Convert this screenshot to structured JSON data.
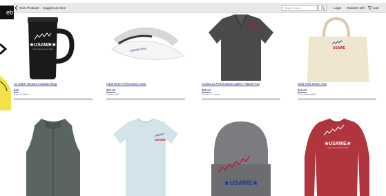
{
  "left_strip": {
    "badge_text": "eb"
  },
  "nav": {
    "new_products": "New Products",
    "suggest_item": "Suggest an Item",
    "search_placeholder": "Search Store",
    "login": "Login",
    "redeem_gift": "Redeem Gift",
    "cart": "Cart"
  },
  "products": [
    {
      "title": "oz. Black Vacuum Insulated Mug",
      "price": "$30",
      "brand": "Jazz Galtinz"
    },
    {
      "title": "Adult Drive Performance Visor",
      "price": "$20.00",
      "brand": "Game Mill"
    },
    {
      "title": "CrownLux Performance Ladies' Plaited Polo",
      "price": "$39.00",
      "brand": "Devon & Jones"
    },
    {
      "title": "Ideal Twill Jumbo Tote",
      "price": "$19.00",
      "brand": "Port Authority®"
    }
  ],
  "logo": {
    "text": "USAWE",
    "sub": "USA WOMEN'S EQUESTRIAN"
  },
  "colors": {
    "nav_bg": "#e9e9ec",
    "link": "#1c2a7a",
    "rule": "#5b4d8a",
    "accent_red": "#c8102e",
    "accent_blue": "#1f3a93"
  },
  "icons": [
    "search-icon",
    "cart-icon"
  ]
}
